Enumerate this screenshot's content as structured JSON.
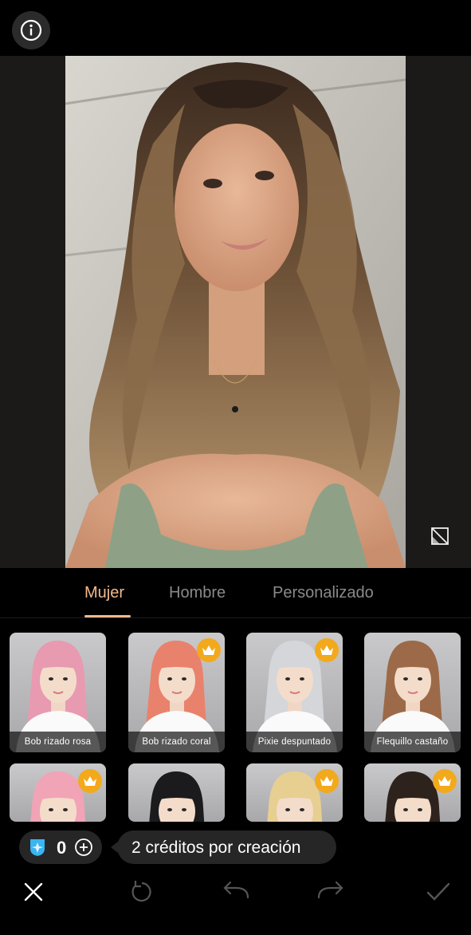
{
  "header": {
    "info_icon": "info-icon"
  },
  "photo": {
    "compare_icon": "compare-icon"
  },
  "tabs": [
    {
      "label": "Mujer",
      "active": true
    },
    {
      "label": "Hombre",
      "active": false
    },
    {
      "label": "Personalizado",
      "active": false
    }
  ],
  "styles": [
    {
      "label": "Bob rizado rosa",
      "premium": false,
      "hair": "#e89ab0"
    },
    {
      "label": "Bob rizado coral",
      "premium": true,
      "hair": "#e9826c"
    },
    {
      "label": "Pixie despuntado",
      "premium": true,
      "hair": "#d4d6da"
    },
    {
      "label": "Flequillo castaño",
      "premium": false,
      "hair": "#9c6a48"
    },
    {
      "label": "",
      "premium": true,
      "hair": "#f0a4b6"
    },
    {
      "label": "",
      "premium": false,
      "hair": "#1b1b1d"
    },
    {
      "label": "",
      "premium": true,
      "hair": "#e7cf92"
    },
    {
      "label": "",
      "premium": true,
      "hair": "#2e221c"
    }
  ],
  "credits": {
    "count": "0",
    "tip": "2 créditos por creación",
    "accent": "#3ab4f2"
  },
  "toolbar": {
    "icons": [
      "close-icon",
      "reset-icon",
      "undo-icon",
      "redo-icon",
      "confirm-icon"
    ]
  },
  "colors": {
    "accent": "#f3b98d",
    "crown": "#f2a91c"
  }
}
